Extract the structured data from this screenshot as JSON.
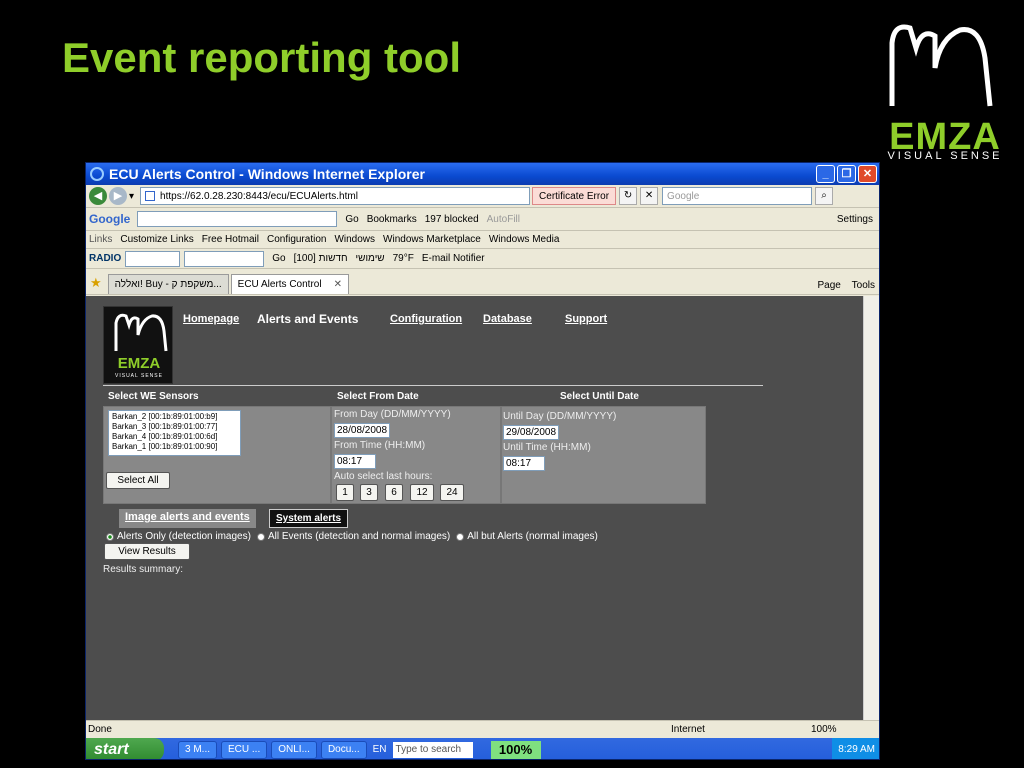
{
  "slide": {
    "title": "Event reporting tool",
    "brand_word": "EMZA",
    "brand_sub": "VISUAL SENSE"
  },
  "window": {
    "title": "ECU Alerts Control - Windows Internet Explorer",
    "min": "_",
    "max": "❐",
    "close": "✕"
  },
  "addressbar": {
    "url": "https://62.0.28.230:8443/ecu/ECUAlerts.html",
    "cert_error": "Certificate Error",
    "search_placeholder": "Google"
  },
  "google_toolbar": {
    "brand": "Google",
    "go": "Go",
    "bookmarks": "Bookmarks",
    "blocked": "197 blocked",
    "autofill": "AutoFill",
    "settings": "Settings"
  },
  "links_bar": {
    "label": "Links",
    "items": [
      "Customize Links",
      "Free Hotmail",
      "Configuration",
      "Windows",
      "Windows Marketplace",
      "Windows Media"
    ]
  },
  "radio_bar": {
    "brand": "RADIO",
    "go": "Go",
    "news": "חדשות [100]",
    "hebrew2": "שימושי",
    "temp": "79°F",
    "email": "E-mail Notifier"
  },
  "tabs": {
    "tab1": "ואללה! Buy - משקפת ק...",
    "tab2": "ECU Alerts Control",
    "page_menu": "Page",
    "tools_menu": "Tools"
  },
  "page": {
    "logo_word": "EMZA",
    "logo_sub": "VISUAL SENSE",
    "nav": {
      "homepage": "Homepage",
      "current": "Alerts and Events",
      "configuration": "Configuration",
      "database": "Database",
      "support": "Support"
    },
    "headers": {
      "sensors": "Select WE Sensors",
      "from": "Select From Date",
      "until": "Select Until Date"
    },
    "sensors": [
      "Barkan_2  [00:1b:89:01:00:b9]",
      "Barkan_3  [00:1b:89:01:00:77]",
      "Barkan_4  [00:1b:89:01:00:6d]",
      "Barkan_1  [00:1b:89:01:00:90]"
    ],
    "select_all": "Select All",
    "from_day_label": "From Day (DD/MM/YYYY)",
    "from_day_value": "28/08/2008",
    "from_time_label": "From Time (HH:MM)",
    "from_time_value": "08:17",
    "auto_label": "Auto select last hours:",
    "auto_hours": [
      "1",
      "3",
      "6",
      "12",
      "24"
    ],
    "until_day_label": "Until Day (DD/MM/YYYY)",
    "until_day_value": "29/08/2008",
    "until_time_label": "Until Time (HH:MM)",
    "until_time_value": "08:17",
    "tab_images": "Image alerts and events",
    "tab_system": "System alerts",
    "radio_options": [
      "Alerts Only (detection images)",
      "All Events (detection and normal images)",
      "All but Alerts (normal images)"
    ],
    "view_results": "View Results",
    "results_summary": "Results summary:"
  },
  "status": {
    "done": "Done",
    "zone": "Internet",
    "zoom": "100%"
  },
  "taskbar": {
    "start": "start",
    "tasks": [
      "3 M...",
      "ECU ...",
      "ONLI...",
      "Docu..."
    ],
    "lang": "EN",
    "search_placeholder": "Type to search",
    "zoom": "100%",
    "clock": "8:29 AM"
  }
}
